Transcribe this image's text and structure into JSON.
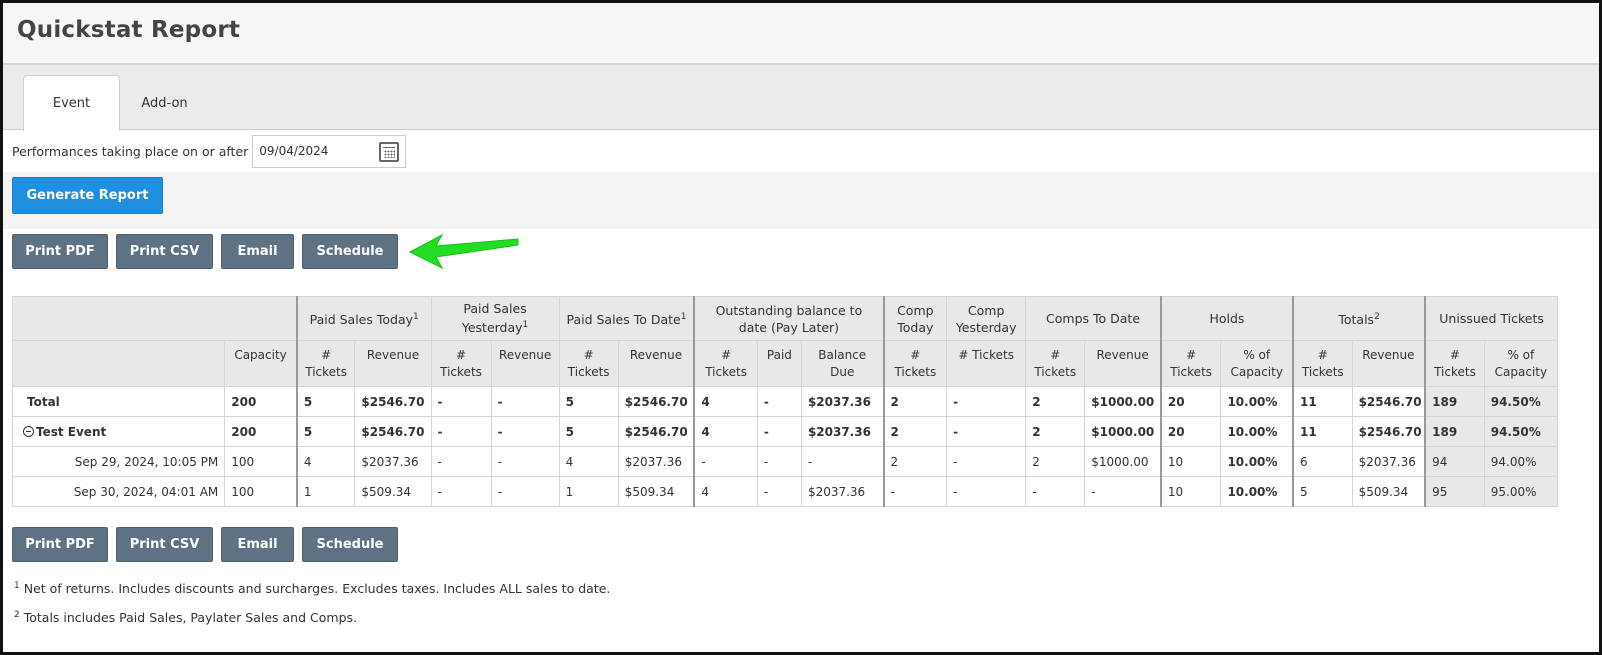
{
  "page": {
    "title": "Quickstat Report"
  },
  "tabs": [
    {
      "label": "Event",
      "active": true
    },
    {
      "label": "Add-on",
      "active": false
    }
  ],
  "filter": {
    "label": "Performances taking place on or after",
    "date_value": "09/04/2024"
  },
  "generate_label": "Generate Report",
  "actions": {
    "print_pdf": "Print PDF",
    "print_csv": "Print CSV",
    "email": "Email",
    "schedule": "Schedule"
  },
  "colors": {
    "primary_button": "#1f8fe0",
    "secondary_button": "#5f7283",
    "annotation_arrow": "#22dd22"
  },
  "table": {
    "group_headers": {
      "paid_today": "Paid Sales Today",
      "paid_yesterday": "Paid Sales Yesterday",
      "paid_to_date": "Paid Sales To Date",
      "outstanding": "Outstanding balance to date (Pay Later)",
      "comp_today": "Comp Today",
      "comp_yesterday": "Comp Yesterday",
      "comps_to_date": "Comps To Date",
      "holds": "Holds",
      "totals": "Totals",
      "unissued": "Unissued Tickets"
    },
    "sub_headers": {
      "capacity": "Capacity",
      "tickets": "# Tickets",
      "revenue": "Revenue",
      "paid": "Paid",
      "balance_due": "Balance Due",
      "pct_capacity": "% of Capacity"
    },
    "footnote_marks": {
      "one": "1",
      "two": "2"
    },
    "rows": [
      {
        "label": "Total",
        "cells": [
          "200",
          "5",
          "$2546.70",
          "-",
          "-",
          "5",
          "$2546.70",
          "4",
          "-",
          "$2037.36",
          "2",
          "-",
          "2",
          "$1000.00",
          "20",
          "10.00%",
          "11",
          "$2546.70",
          "189",
          "94.50%"
        ]
      },
      {
        "label": "Test Event",
        "cells": [
          "200",
          "5",
          "$2546.70",
          "-",
          "-",
          "5",
          "$2546.70",
          "4",
          "-",
          "$2037.36",
          "2",
          "-",
          "2",
          "$1000.00",
          "20",
          "10.00%",
          "11",
          "$2546.70",
          "189",
          "94.50%"
        ]
      },
      {
        "label": "Sep 29, 2024, 10:05 PM",
        "cells": [
          "100",
          "4",
          "$2037.36",
          "-",
          "-",
          "4",
          "$2037.36",
          "-",
          "-",
          "-",
          "2",
          "-",
          "2",
          "$1000.00",
          "10",
          "10.00%",
          "6",
          "$2037.36",
          "94",
          "94.00%"
        ]
      },
      {
        "label": "Sep 30, 2024, 04:01 AM",
        "cells": [
          "100",
          "1",
          "$509.34",
          "-",
          "-",
          "1",
          "$509.34",
          "4",
          "-",
          "$2037.36",
          "-",
          "-",
          "-",
          "-",
          "10",
          "10.00%",
          "5",
          "$509.34",
          "95",
          "95.00%"
        ]
      }
    ]
  },
  "footnotes": [
    {
      "mark": "1",
      "text": "Net of returns. Includes discounts and surcharges. Excludes taxes. Includes ALL sales to date."
    },
    {
      "mark": "2",
      "text": "Totals includes Paid Sales, Paylater Sales and Comps."
    }
  ]
}
